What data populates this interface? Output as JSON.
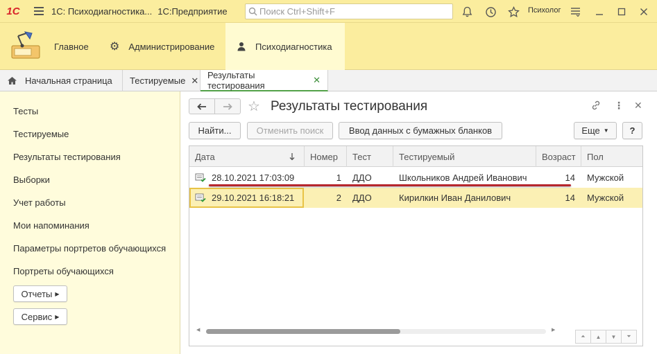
{
  "titlebar": {
    "logo": "1С",
    "app_title": "1С: Психодиагностика...",
    "platform": "1С:Предприятие",
    "search_placeholder": "Поиск Ctrl+Shift+F",
    "user": "Психолог"
  },
  "sections": [
    {
      "label": "Главное",
      "icon": "desk-lamp-icon"
    },
    {
      "label": "Администрирование",
      "icon": "gear-icon"
    },
    {
      "label": "Психодиагностика",
      "icon": "person-icon"
    }
  ],
  "tabs": [
    {
      "label": "Начальная страница",
      "icon": "home-icon"
    },
    {
      "label": "Тестируемые"
    },
    {
      "label": "Результаты тестирования"
    }
  ],
  "nav": {
    "items": [
      "Тесты",
      "Тестируемые",
      "Результаты тестирования",
      "Выборки",
      "Учет работы",
      "Мои напоминания",
      "Параметры портретов обучающихся",
      "Портреты обучающихся"
    ],
    "buttons": [
      "Отчеты",
      "Сервис"
    ]
  },
  "form": {
    "title": "Результаты тестирования",
    "buttons": {
      "find": "Найти...",
      "cancel_search": "Отменить поиск",
      "paper_input": "Ввод данных с бумажных бланков",
      "more": "Еще",
      "help": "?"
    }
  },
  "table": {
    "columns": [
      "Дата",
      "Номер",
      "Тест",
      "Тестируемый",
      "Возраст",
      "Пол"
    ],
    "rows": [
      {
        "date": "28.10.2021 17:03:09",
        "number": "1",
        "test": "ДДО",
        "person": "Школьников Андрей Иванович",
        "age": "14",
        "sex": "Мужской"
      },
      {
        "date": "29.10.2021 16:18:21",
        "number": "2",
        "test": "ДДО",
        "person": "Кирилкин Иван Данилович",
        "age": "14",
        "sex": "Мужской"
      }
    ]
  },
  "colors": {
    "accent_yellow": "#fbed9e",
    "selection": "#fbf0b4",
    "active_tab_line": "#52a147",
    "underline": "#b7262c"
  }
}
